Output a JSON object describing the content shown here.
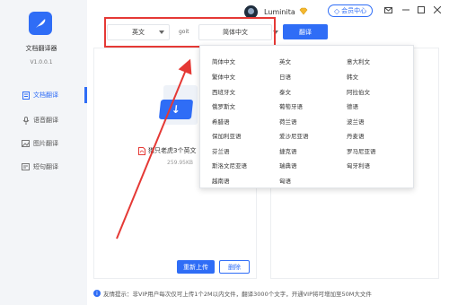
{
  "app": {
    "name": "文档翻译器",
    "version": "V1.0.0.1"
  },
  "sidebar": {
    "items": [
      {
        "label": "文档翻译",
        "icon": "document-icon",
        "active": true
      },
      {
        "label": "语音翻译",
        "icon": "microphone-icon",
        "active": false
      },
      {
        "label": "图片翻译",
        "icon": "image-icon",
        "active": false
      },
      {
        "label": "短句翻译",
        "icon": "sentence-icon",
        "active": false
      }
    ]
  },
  "titlebar": {
    "username": "Luminita",
    "vip_center": "会员中心",
    "window_buttons": [
      "mail-icon",
      "minimize-icon",
      "maximize-icon",
      "close-icon"
    ]
  },
  "toolbar": {
    "source_language": "英文",
    "swap_label": "goit",
    "target_language": "简体中文",
    "translate_button": "翻译"
  },
  "file": {
    "name": "猎只老虎3个英文",
    "size": "259.95KB",
    "reupload_button": "重新上传",
    "delete_button": "删除"
  },
  "dropdown": {
    "columns": [
      [
        "简体中文",
        "繁体中文",
        "西班牙文",
        "俄罗斯文",
        "希腊语",
        "保加利亚语",
        "芬兰语",
        "斯洛文尼亚语",
        "越南语"
      ],
      [
        "英文",
        "日语",
        "泰文",
        "葡萄牙语",
        "荷兰语",
        "爱沙尼亚语",
        "捷克语",
        "瑞典语",
        "匈语"
      ],
      [
        "意大利文",
        "韩文",
        "阿拉伯文",
        "德语",
        "波兰语",
        "丹麦语",
        "罗马尼亚语",
        "匈牙利语"
      ]
    ]
  },
  "footer": {
    "tip": "友情提示：非VIP用户每次仅可上传1个2M以内文件，翻译3000个文字，开通VIP将可增加至50M大文件"
  },
  "colors": {
    "accent": "#2f6df6",
    "annotation": "#e53935"
  }
}
